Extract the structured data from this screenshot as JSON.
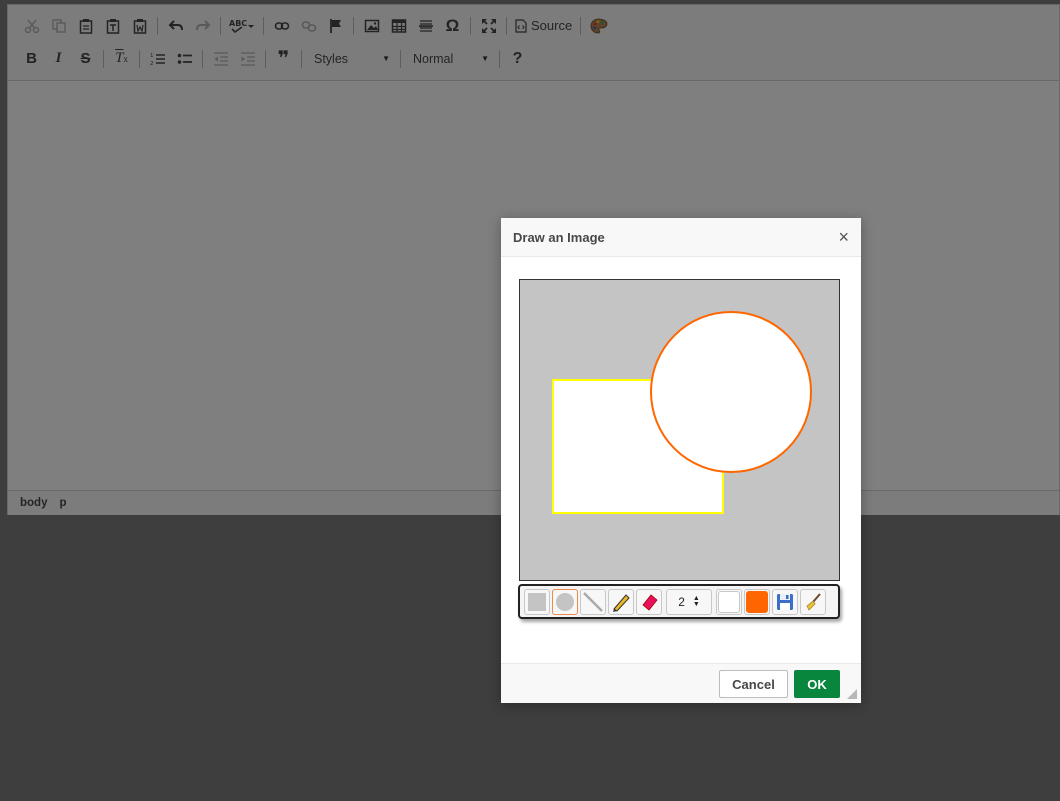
{
  "toolbar": {
    "row1": [
      {
        "icon": "cut-icon",
        "enabled": false
      },
      {
        "icon": "copy-icon",
        "enabled": false
      },
      {
        "icon": "paste-icon",
        "enabled": true
      },
      {
        "icon": "paste-text-icon",
        "enabled": true
      },
      {
        "icon": "paste-from-word-icon",
        "enabled": true
      },
      {
        "icon": "undo-icon",
        "enabled": true
      },
      {
        "icon": "redo-icon",
        "enabled": false
      },
      {
        "icon": "spellcheck-icon",
        "enabled": true
      },
      {
        "icon": "link-icon",
        "enabled": true
      },
      {
        "icon": "unlink-icon",
        "enabled": false
      },
      {
        "icon": "anchor-flag-icon",
        "enabled": true
      },
      {
        "icon": "image-icon",
        "enabled": true
      },
      {
        "icon": "table-icon",
        "enabled": true
      },
      {
        "icon": "horizontal-rule-icon",
        "enabled": true
      },
      {
        "icon": "special-char-icon",
        "enabled": true
      },
      {
        "icon": "maximize-icon",
        "enabled": true
      },
      {
        "icon": "source-icon",
        "enabled": true
      },
      {
        "icon": "palette-icon",
        "enabled": true
      }
    ],
    "special_char_glyph": "Ω",
    "source_label": "Source",
    "bold_label": "B",
    "italic_label": "I",
    "strike_label": "S",
    "remove_format_label": "T",
    "remove_format_sub": "x",
    "blockquote_label": "❞",
    "help_label": "?",
    "styles_combo": "Styles",
    "format_combo": "Normal"
  },
  "statusbar": {
    "path": [
      "body",
      "p"
    ]
  },
  "dialog": {
    "title": "Draw an Image",
    "close_glyph": "×",
    "canvas": {
      "background": "#c4c4c4",
      "rect_stroke": "#ffff00",
      "circle_stroke": "#ff6600",
      "shape_fill": "#ffffff"
    },
    "tools": {
      "tools_list": [
        "rectangle-tool",
        "ellipse-tool",
        "line-tool",
        "pencil-tool",
        "eraser-tool"
      ],
      "active_tool": "ellipse-tool",
      "stroke_width": "2",
      "fill_color": "#ffffff",
      "stroke_color": "#ff6600"
    },
    "cancel_label": "Cancel",
    "ok_label": "OK",
    "ok_color": "#09863e"
  }
}
